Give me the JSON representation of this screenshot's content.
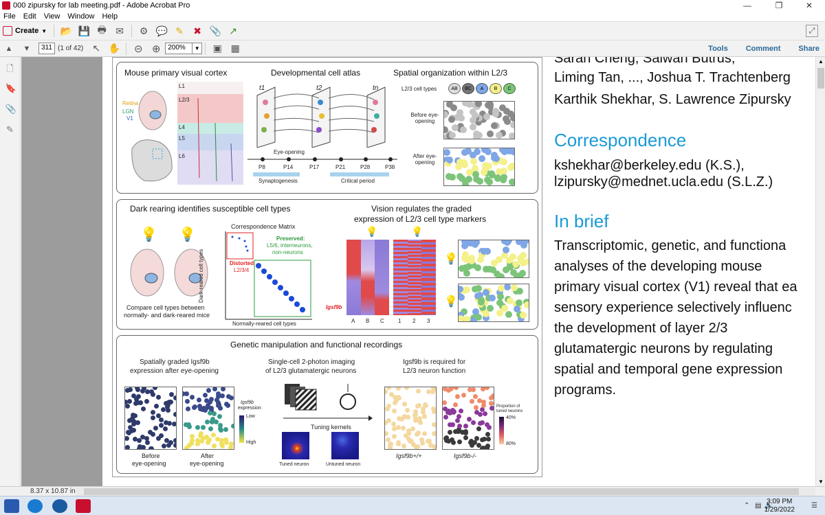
{
  "window": {
    "title": "000 zipursky for lab meeting.pdf - Adobe Acrobat Pro",
    "minimize_icon": "minimize-icon",
    "maximize_icon": "restore-icon",
    "close_icon": "close-icon"
  },
  "menu": [
    "File",
    "Edit",
    "View",
    "Window",
    "Help"
  ],
  "toolbar": {
    "create_label": "Create",
    "icons": [
      "open-icon",
      "save-icon",
      "print-icon",
      "email-icon",
      "settings-icon",
      "comment-icon",
      "highlight-icon",
      "sign-icon",
      "attach-icon",
      "export-icon"
    ]
  },
  "navbar": {
    "page_number": "311",
    "page_of": "(1 of 42)",
    "zoom": "200%",
    "links": [
      "Tools",
      "Comment",
      "Share"
    ]
  },
  "figure": {
    "panel1": {
      "titles": [
        "Mouse primary visual cortex",
        "Developmental cell atlas",
        "Spatial organization within L2/3"
      ],
      "layers": [
        "L1",
        "L2/3",
        "L4",
        "L5",
        "L6"
      ],
      "brain_labels": [
        "Retina",
        "LGN",
        "V1"
      ],
      "time_labels": [
        "t1",
        "t2",
        "tn"
      ],
      "timeline": [
        "P8",
        "P14",
        "P17",
        "P21",
        "P28",
        "P38"
      ],
      "eye_opening": "Eye-opening",
      "synaptogenesis": "Synaptogenesis",
      "critical_period": "Critical period",
      "cell_types_label": "L2/3 cell types",
      "cell_types": [
        "AB",
        "BC",
        "A",
        "B",
        "C"
      ],
      "before": "Before eye-opening",
      "after": "After eye-opening"
    },
    "panel2": {
      "title_left": "Dark rearing identifies susceptible cell types",
      "title_right_1": "Vision regulates the graded",
      "title_right_2": "expression of L2/3 cell type markers",
      "matrix_title": "Correspondence Matrix",
      "preserved": "Preserved:",
      "preserved_detail_1": "L5/6, interneurons,",
      "preserved_detail_2": "non-neurons",
      "distorted_1": "Distorted",
      "distorted_2": "L2/3/4",
      "yaxis": "Dark-reared cell types",
      "xaxis": "Normally-reared cell types",
      "compare_1": "Compare cell types between",
      "compare_2": "normally- and dark-reared mice",
      "gene": "Igsf9b",
      "heat_cols_1": [
        "A",
        "B",
        "C"
      ],
      "heat_cols_2": [
        "1",
        "2",
        "3"
      ]
    },
    "panel3": {
      "title": "Genetic manipulation and functional recordings",
      "col1_1": "Spatially graded Igsf9b",
      "col1_2": "expression after eye-opening",
      "col2_1": "Single-cell 2-photon imaging",
      "col2_2": "of L2/3 glutamatergic neurons",
      "col3_1": "Igsf9b is required for",
      "col3_2": "L2/3 neuron function",
      "expr_label_1": "Igsf9b",
      "expr_label_2": "expression",
      "low": "Low",
      "high": "High",
      "before_1": "Before",
      "before_2": "eye-opening",
      "after_1": "After",
      "after_2": "eye-opening",
      "tuning": "Tuning kernels",
      "tuned": "Tuned neuron",
      "untuned": "Untuned neuron",
      "wt": "Igsf9b+/+",
      "ko": "Igsf9b-/-",
      "prop_1": "Proportion of",
      "prop_2": "tuned neurons",
      "p40": "40%",
      "p80": "80%"
    }
  },
  "text": {
    "authors_1": "Sarah Cheng, Salwan Butrus,",
    "authors_2": "Liming Tan, ..., Joshua T. Trachtenberg",
    "authors_3": "Karthik Shekhar, S. Lawrence Zipursky",
    "correspondence_head": "Correspondence",
    "email_1": "kshekhar@berkeley.edu (K.S.),",
    "email_2": "lzipursky@mednet.ucla.edu (S.L.Z.)",
    "inbrief_head": "In brief",
    "brief": [
      "Transcriptomic, genetic, and functiona",
      "analyses of the developing mouse",
      "primary visual cortex (V1) reveal that ea",
      "sensory experience selectively influenc",
      "the development of layer 2/3",
      "glutamatergic neurons by regulating",
      "spatial and temporal gene expression",
      "programs."
    ]
  },
  "status": {
    "page_size": "8.37 x 10.87 in"
  },
  "taskbar": {
    "time": "3:09 PM",
    "date": "1/29/2022"
  },
  "colors": {
    "accent": "#1a9ad6",
    "acrobat_red": "#c8102e",
    "link": "#2c6a97"
  }
}
